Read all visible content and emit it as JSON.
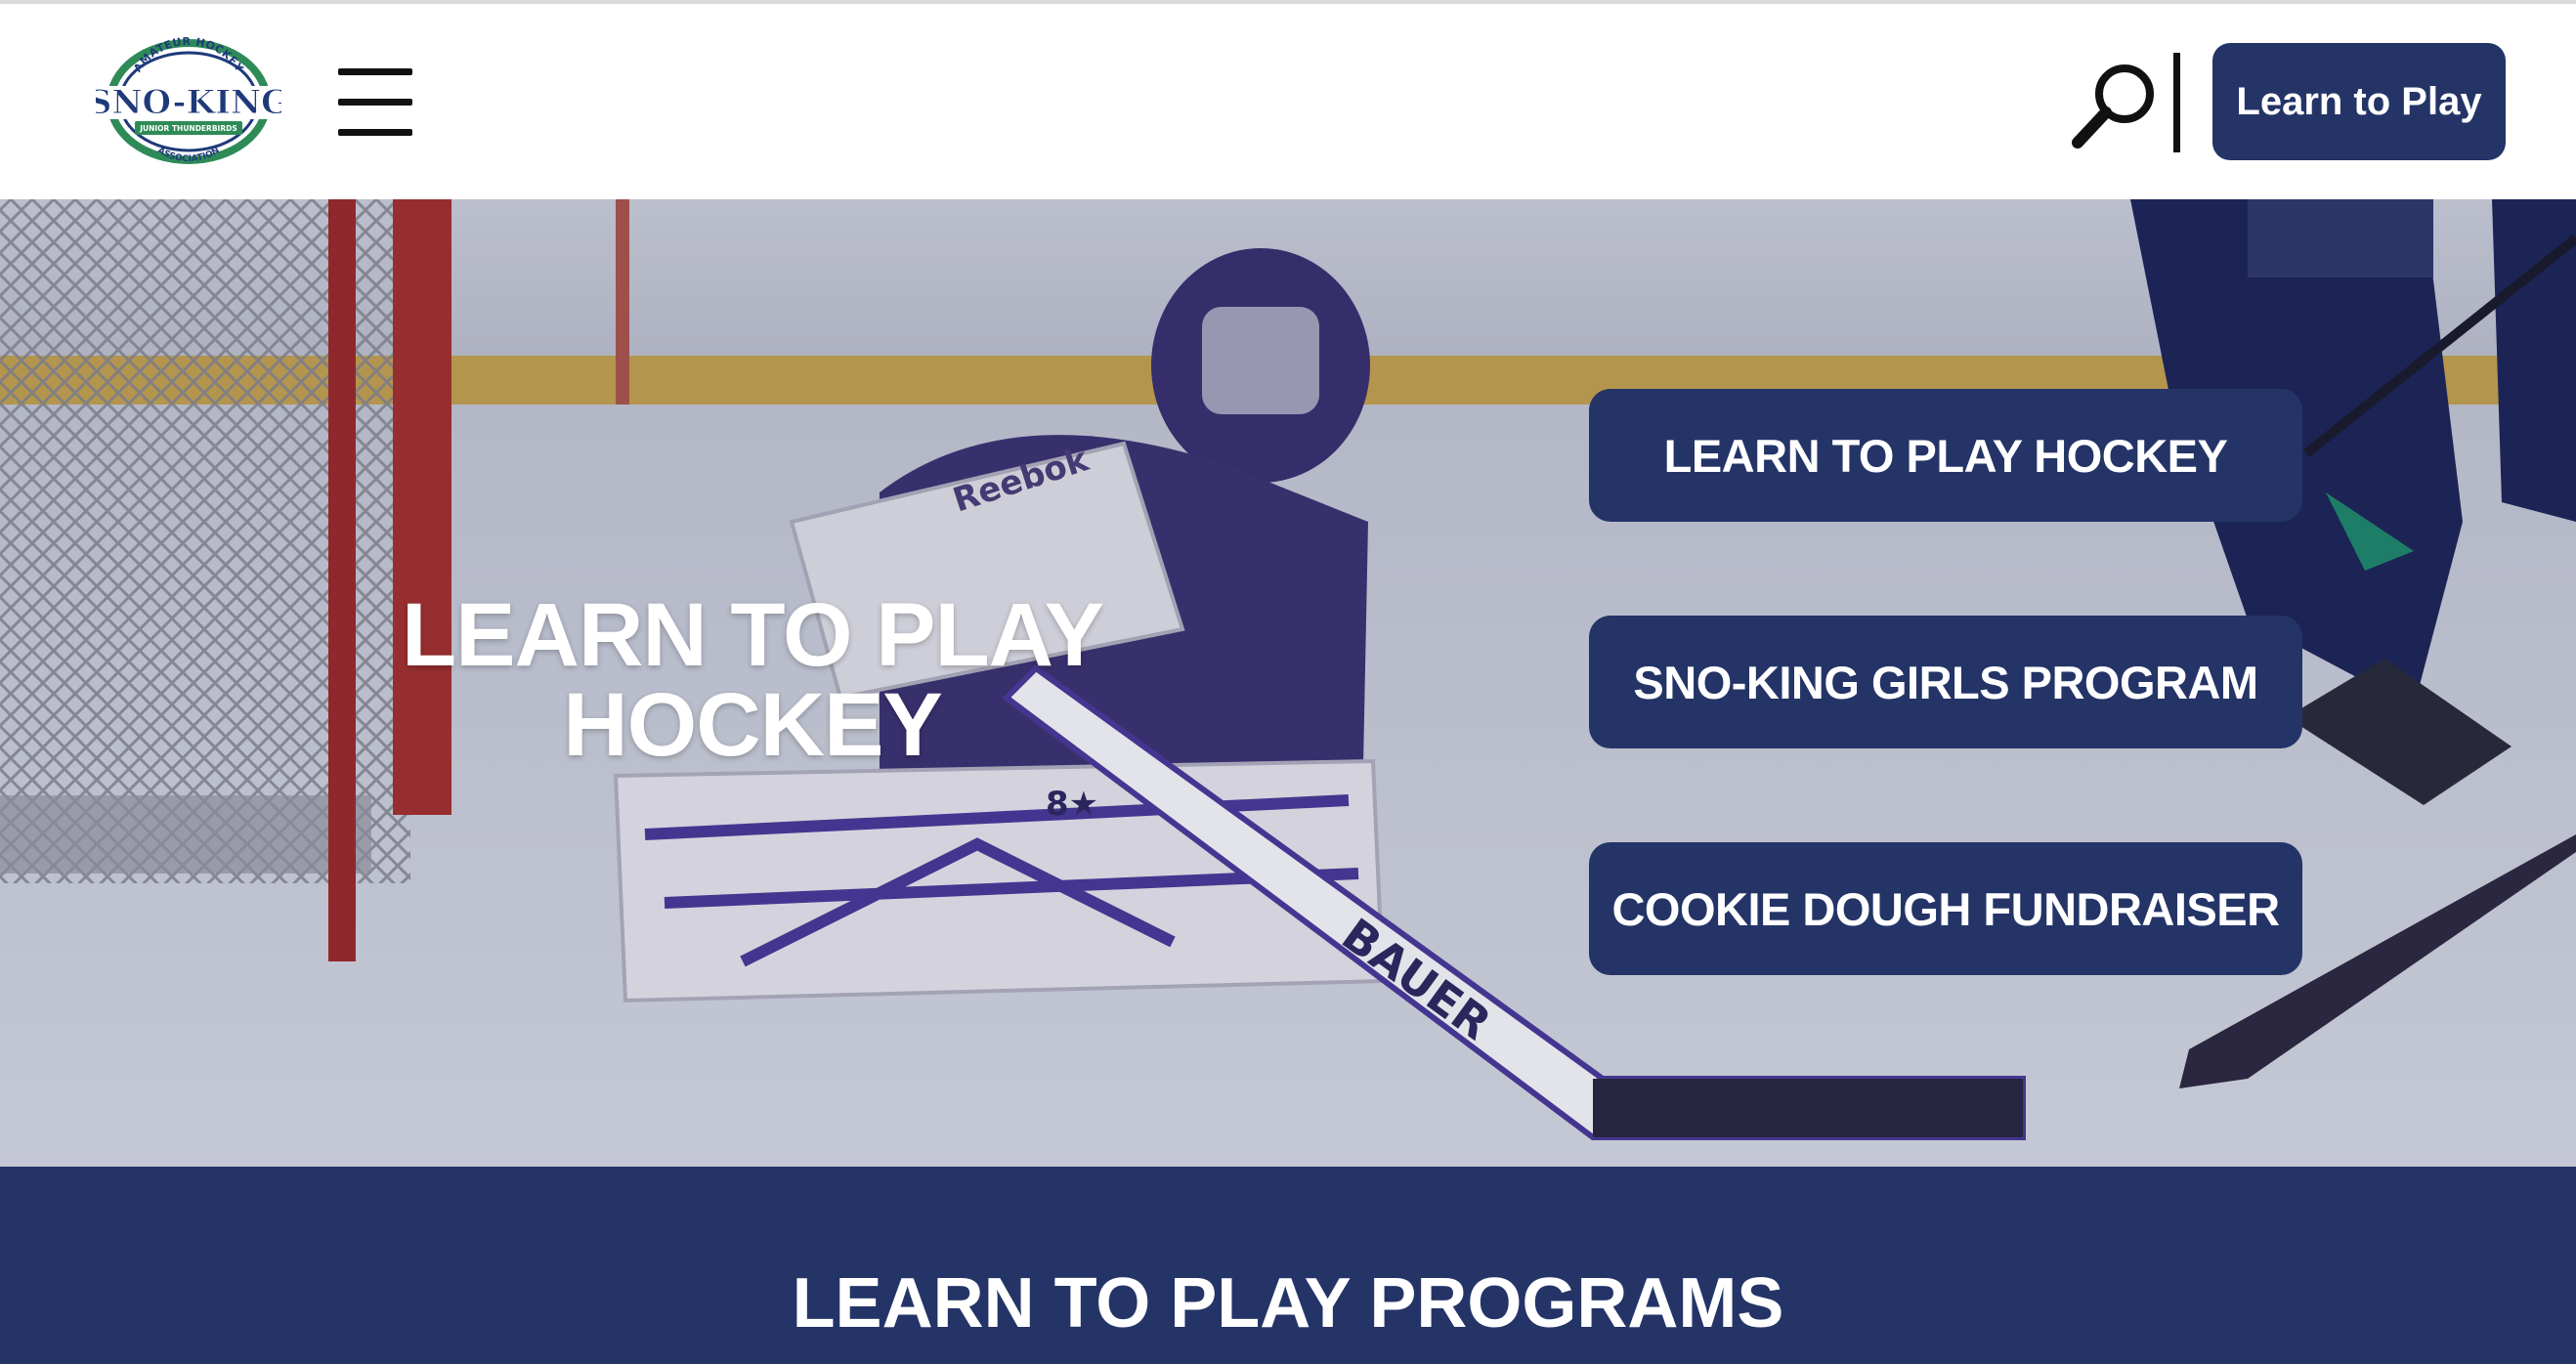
{
  "header": {
    "logo": {
      "icon": "sno-king-association-logo",
      "arc_top": "AMATEUR HOCKEY",
      "name": "SNO-KING",
      "ribbon": "JUNIOR THUNDERBIRDS",
      "arc_bottom": "ASSOCIATION"
    },
    "menu_icon": "hamburger-menu-icon",
    "search_icon": "search-icon",
    "cta_label": "Learn to Play"
  },
  "hero": {
    "title_line1": "LEARN TO PLAY",
    "title_line2": "HOCKEY",
    "buttons": [
      {
        "label": "LEARN TO PLAY HOCKEY"
      },
      {
        "label": "SNO-KING GIRLS PROGRAM"
      },
      {
        "label": "COOKIE DOUGH FUNDRAISER"
      }
    ],
    "photo_text": {
      "helmet_brand": "Reebok",
      "pad_brand": "8★",
      "stick_brand": "BAUER"
    }
  },
  "programs": {
    "title": "LEARN TO PLAY PROGRAMS"
  },
  "colors": {
    "brand_navy": "#243467",
    "header_bg": "#ffffff",
    "text_on_navy": "#ffffff",
    "logo_green": "#2e8b57",
    "logo_blue": "#1f3a7a"
  }
}
